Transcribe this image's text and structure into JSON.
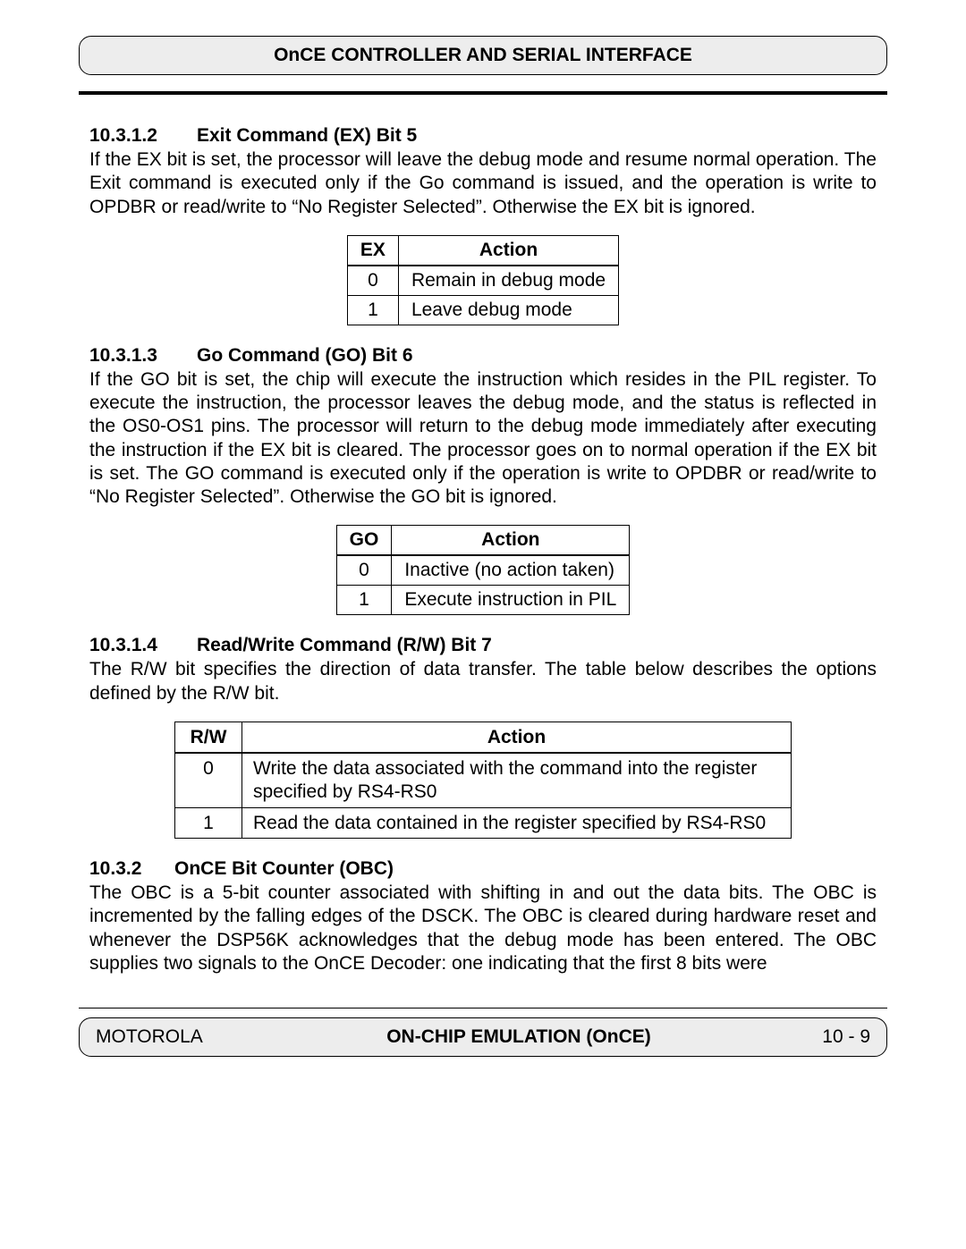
{
  "header": {
    "title": "OnCE CONTROLLER AND SERIAL INTERFACE"
  },
  "sections": {
    "sec_10_3_1_2": {
      "num": "10.3.1.2",
      "title": "Exit Command (EX) Bit 5",
      "para": "If the EX bit is set, the processor will leave the debug mode and resume normal operation. The Exit command is executed only if the Go command is issued, and the operation is write to OPDBR or read/write to “No Register Selected”. Otherwise the EX bit is ignored.",
      "table": {
        "headers": [
          "EX",
          "Action"
        ],
        "rows": [
          [
            "0",
            "Remain in debug mode"
          ],
          [
            "1",
            "Leave debug mode"
          ]
        ]
      }
    },
    "sec_10_3_1_3": {
      "num": "10.3.1.3",
      "title": "Go Command (GO) Bit 6",
      "para": "If the GO bit is set, the chip will execute the instruction which resides in the PIL register. To execute the instruction, the processor leaves the debug mode, and the status is reflected in the OS0-OS1 pins. The processor will return to the debug mode immediately after executing the instruction if the EX bit is cleared. The processor goes on to normal operation if the EX bit is set. The GO command is executed only if the operation is write to OPDBR or read/write to “No Register Selected”. Otherwise the GO bit is ignored.",
      "table": {
        "headers": [
          "GO",
          "Action"
        ],
        "rows": [
          [
            "0",
            "Inactive (no action taken)"
          ],
          [
            "1",
            "Execute instruction in PIL"
          ]
        ]
      }
    },
    "sec_10_3_1_4": {
      "num": "10.3.1.4",
      "title": "Read/Write Command (R/W) Bit 7",
      "para": "The R/W bit specifies the direction of data transfer. The table below describes the options defined by the R/W bit.",
      "table": {
        "headers": [
          "R/W",
          "Action"
        ],
        "rows": [
          [
            "0",
            "Write the data associated with the command into the register specified by RS4-RS0"
          ],
          [
            "1",
            "Read the data contained in the register specified by RS4-RS0"
          ]
        ]
      }
    },
    "sec_10_3_2": {
      "num": "10.3.2",
      "title": "OnCE Bit Counter (OBC)",
      "para": "The OBC is a 5-bit counter associated with shifting in and out the data bits. The OBC is incremented by the falling edges of the DSCK. The OBC is cleared during hardware reset and whenever the DSP56K acknowledges that the debug mode has been entered. The OBC supplies two signals to the OnCE Decoder: one indicating that the first 8 bits were"
    }
  },
  "footer": {
    "left": "MOTOROLA",
    "center": "ON-CHIP EMULATION (OnCE)",
    "right": "10 - 9"
  }
}
